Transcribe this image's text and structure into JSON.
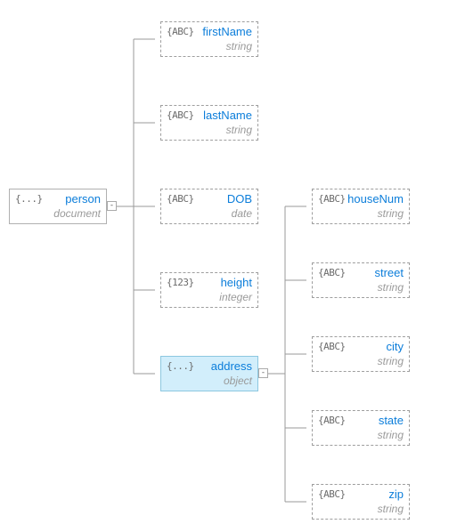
{
  "icons": {
    "object": "{...}",
    "string": "{ABC}",
    "integer": "{123}"
  },
  "root": {
    "name": "person",
    "type": "document",
    "iconKey": "object"
  },
  "children": [
    {
      "name": "firstName",
      "type": "string",
      "iconKey": "string"
    },
    {
      "name": "lastName",
      "type": "string",
      "iconKey": "string"
    },
    {
      "name": "DOB",
      "type": "date",
      "iconKey": "string"
    },
    {
      "name": "height",
      "type": "integer",
      "iconKey": "integer"
    },
    {
      "name": "address",
      "type": "object",
      "iconKey": "object",
      "selected": true
    }
  ],
  "addressChildren": [
    {
      "name": "houseNum",
      "type": "string",
      "iconKey": "string"
    },
    {
      "name": "street",
      "type": "string",
      "iconKey": "string"
    },
    {
      "name": "city",
      "type": "string",
      "iconKey": "string"
    },
    {
      "name": "state",
      "type": "string",
      "iconKey": "string"
    },
    {
      "name": "zip",
      "type": "string",
      "iconKey": "string"
    }
  ]
}
